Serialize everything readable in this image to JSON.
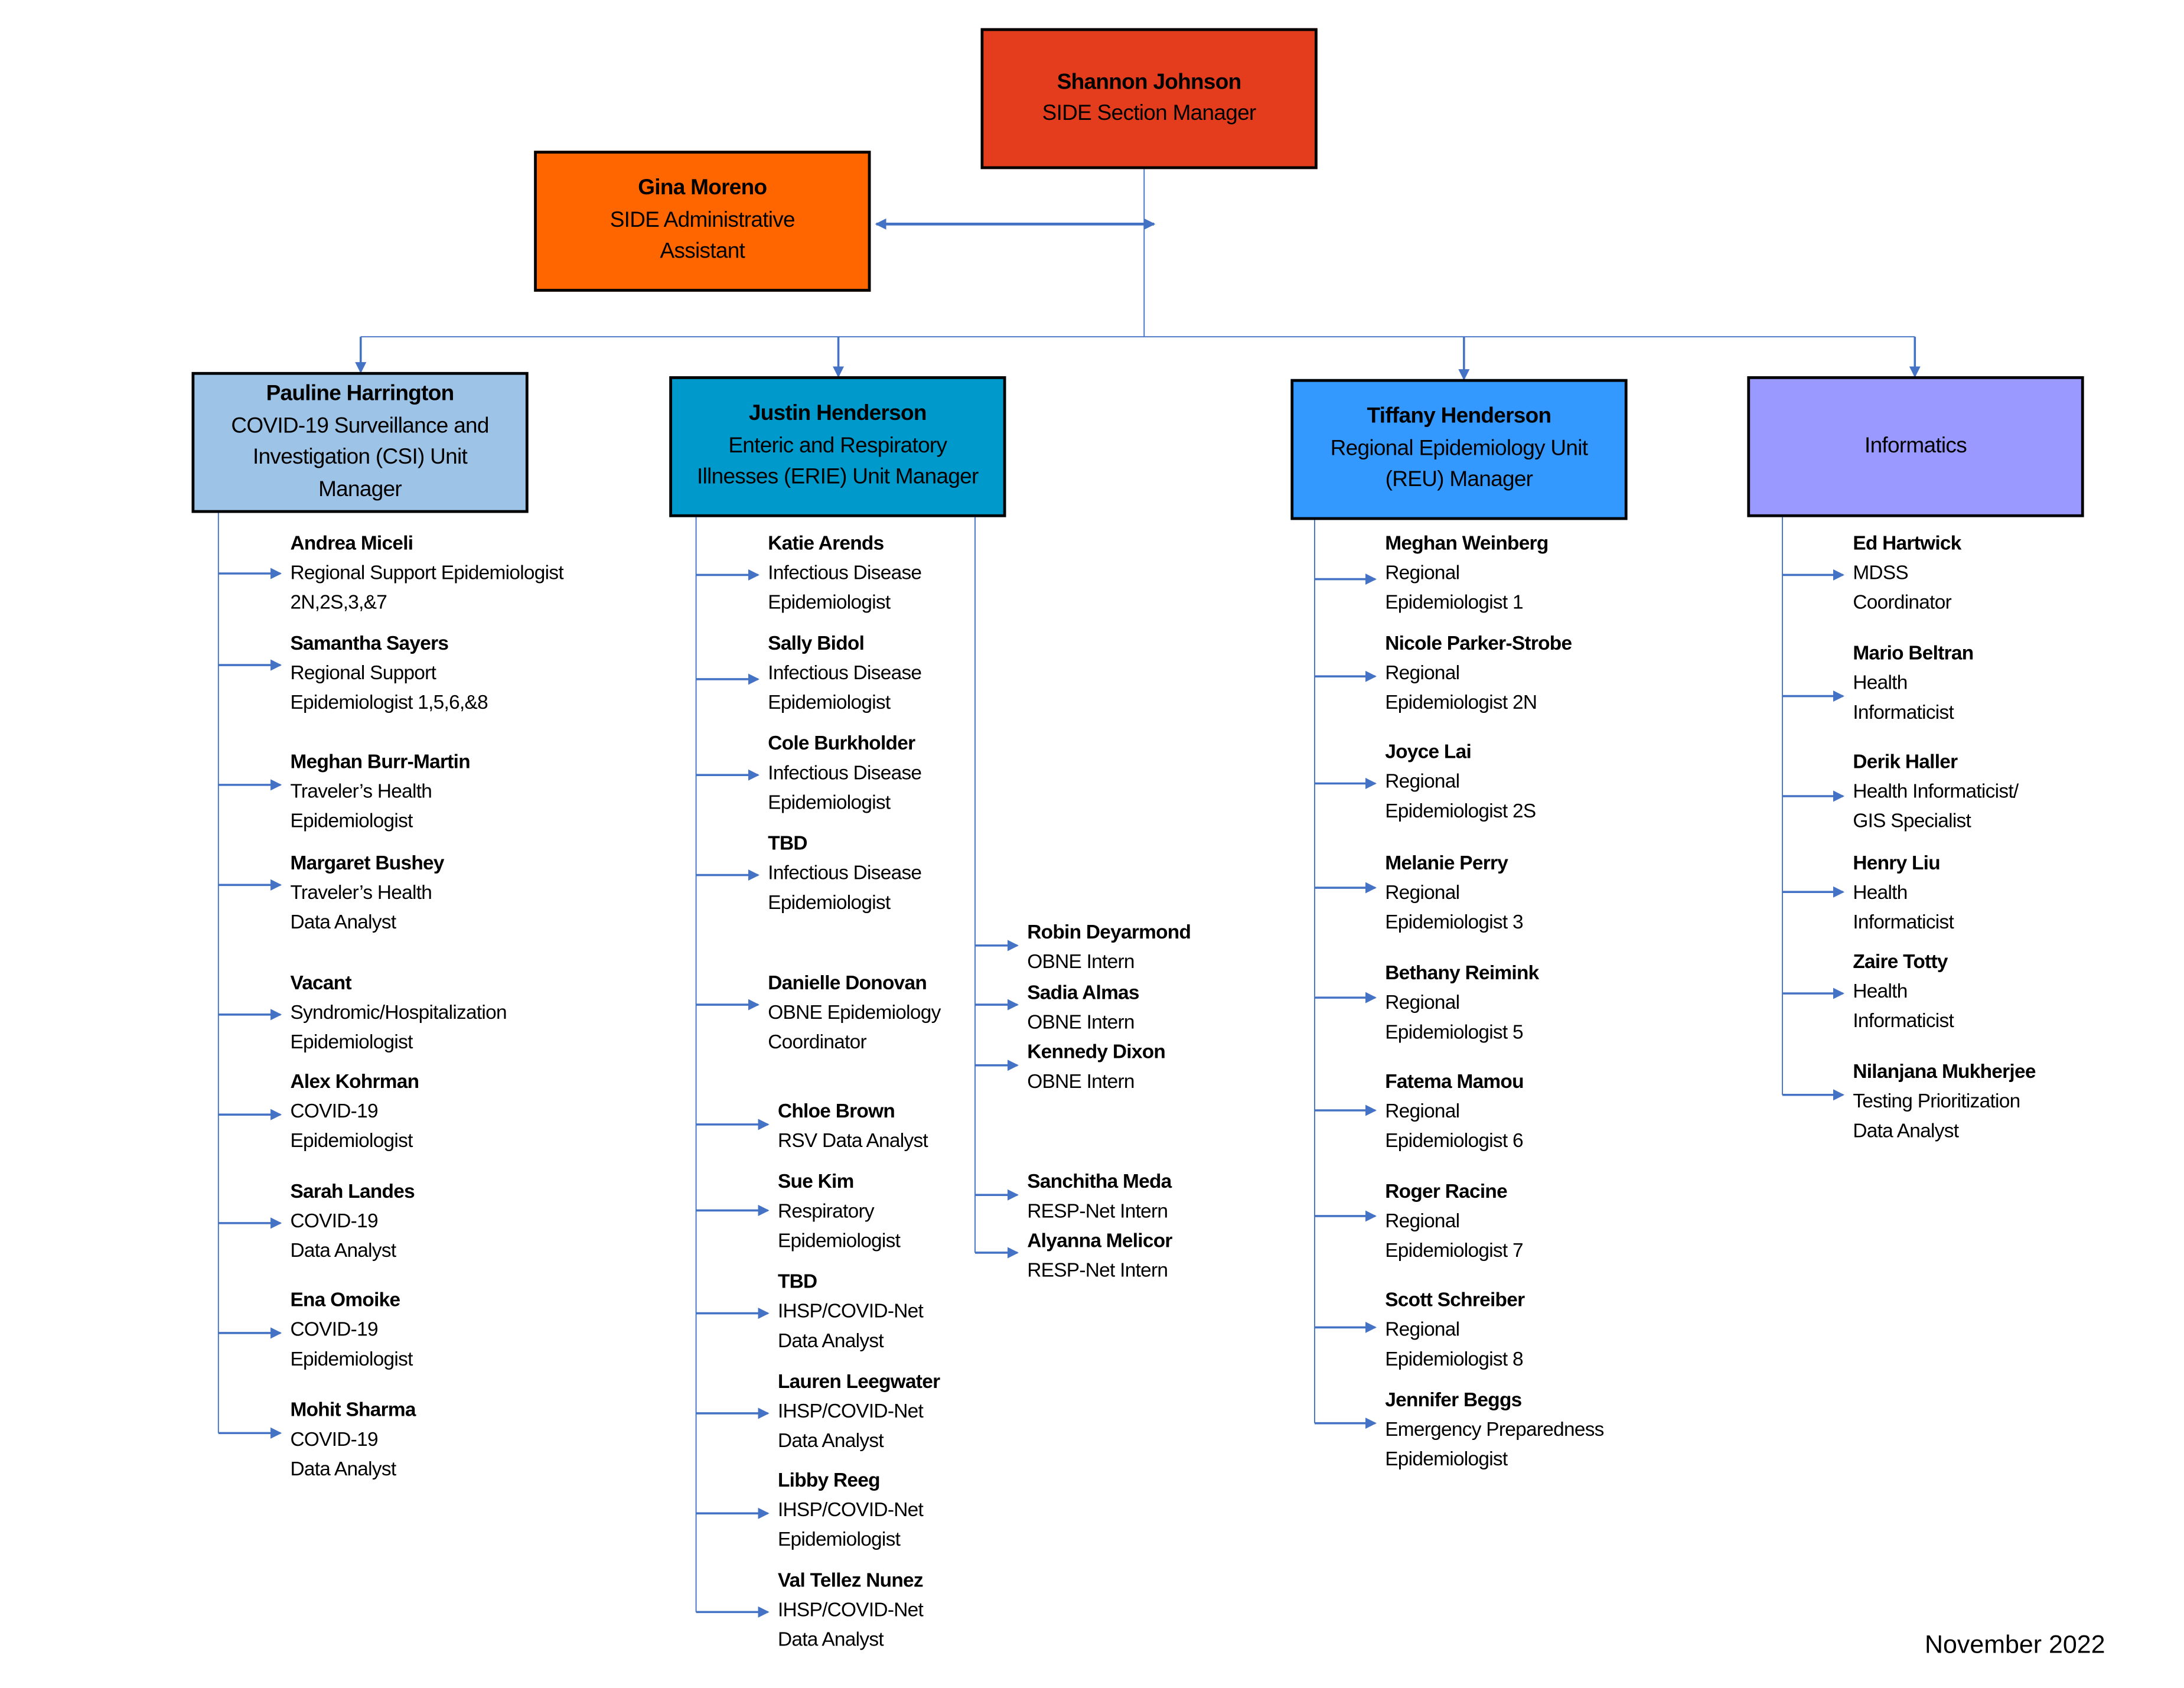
{
  "top": {
    "manager": {
      "name": "Shannon Johnson",
      "title": "SIDE Section Manager",
      "color": "#E33D1E"
    },
    "assistant": {
      "name": "Gina Moreno",
      "title_lines": [
        "SIDE Administrative",
        "Assistant"
      ],
      "color": "#FF6600"
    }
  },
  "units": [
    {
      "name": "Pauline Harrington",
      "title_lines": [
        "COVID-19 Surveillance and",
        "Investigation (CSI) Unit",
        "Manager"
      ],
      "color": "#9DC3E6",
      "staff": [
        {
          "name": "Andrea Miceli",
          "title_lines": [
            "Regional Support Epidemiologist",
            "2N,2S,3,&7"
          ]
        },
        {
          "name": "Samantha Sayers",
          "title_lines": [
            "Regional Support",
            "Epidemiologist 1,5,6,&8"
          ]
        },
        {
          "name": "Meghan Burr-Martin",
          "title_lines": [
            "Traveler’s Health",
            "Epidemiologist"
          ]
        },
        {
          "name": "Margaret Bushey",
          "title_lines": [
            "Traveler’s Health",
            "Data Analyst"
          ]
        },
        {
          "name": "Vacant",
          "title_lines": [
            "Syndromic/Hospitalization",
            "Epidemiologist"
          ]
        },
        {
          "name": "Alex Kohrman",
          "title_lines": [
            "COVID-19",
            "Epidemiologist"
          ]
        },
        {
          "name": "Sarah Landes",
          "title_lines": [
            "COVID-19",
            "Data Analyst"
          ]
        },
        {
          "name": "Ena Omoike",
          "title_lines": [
            "COVID-19",
            "Epidemiologist"
          ]
        },
        {
          "name": "Mohit Sharma",
          "title_lines": [
            "COVID-19",
            "Data Analyst"
          ]
        }
      ]
    },
    {
      "name": "Justin Henderson",
      "title_lines": [
        "Enteric and Respiratory",
        "Illnesses (ERIE) Unit Manager"
      ],
      "color": "#0099CC",
      "staff": [
        {
          "name": "Katie Arends",
          "title_lines": [
            "Infectious Disease",
            "Epidemiologist"
          ]
        },
        {
          "name": "Sally Bidol",
          "title_lines": [
            "Infectious Disease",
            "Epidemiologist"
          ]
        },
        {
          "name": "Cole Burkholder",
          "title_lines": [
            "Infectious Disease",
            "Epidemiologist"
          ]
        },
        {
          "name": "TBD",
          "title_lines": [
            "Infectious Disease",
            "Epidemiologist"
          ]
        },
        {
          "name": "Danielle Donovan",
          "title_lines": [
            "OBNE Epidemiology",
            "Coordinator"
          ]
        },
        {
          "name": "Chloe Brown",
          "title_lines": [
            "RSV Data Analyst"
          ]
        },
        {
          "name": "Sue Kim",
          "title_lines": [
            "Respiratory",
            "Epidemiologist"
          ]
        },
        {
          "name": "TBD",
          "title_lines": [
            "IHSP/COVID-Net",
            "Data Analyst"
          ]
        },
        {
          "name": "Lauren Leegwater",
          "title_lines": [
            "IHSP/COVID-Net",
            "Data Analyst"
          ]
        },
        {
          "name": "Libby Reeg",
          "title_lines": [
            "IHSP/COVID-Net",
            "Epidemiologist"
          ]
        },
        {
          "name": "Val Tellez Nunez",
          "title_lines": [
            "IHSP/COVID-Net",
            "Data Analyst"
          ]
        }
      ],
      "interns": [
        {
          "name": "Robin Deyarmond",
          "title_lines": [
            "OBNE Intern"
          ]
        },
        {
          "name": "Sadia Almas",
          "title_lines": [
            "OBNE Intern"
          ]
        },
        {
          "name": "Kennedy Dixon",
          "title_lines": [
            "OBNE Intern"
          ]
        },
        {
          "name": "Sanchitha Meda",
          "title_lines": [
            "RESP-Net Intern"
          ]
        },
        {
          "name": "Alyanna Melicor",
          "title_lines": [
            "RESP-Net Intern"
          ]
        }
      ]
    },
    {
      "name": "Tiffany Henderson",
      "title_lines": [
        "Regional Epidemiology Unit",
        "(REU) Manager"
      ],
      "color": "#3399FF",
      "staff": [
        {
          "name": "Meghan Weinberg",
          "title_lines": [
            "Regional",
            "Epidemiologist 1"
          ]
        },
        {
          "name": "Nicole Parker-Strobe",
          "title_lines": [
            "Regional",
            "Epidemiologist 2N"
          ]
        },
        {
          "name": "Joyce Lai",
          "title_lines": [
            "Regional",
            "Epidemiologist 2S"
          ]
        },
        {
          "name": "Melanie Perry",
          "title_lines": [
            "Regional",
            "Epidemiologist 3"
          ]
        },
        {
          "name": "Bethany Reimink",
          "title_lines": [
            "Regional",
            "Epidemiologist 5"
          ]
        },
        {
          "name": "Fatema Mamou",
          "title_lines": [
            "Regional",
            "Epidemiologist 6"
          ]
        },
        {
          "name": "Roger Racine",
          "title_lines": [
            "Regional",
            "Epidemiologist 7"
          ]
        },
        {
          "name": "Scott Schreiber",
          "title_lines": [
            "Regional",
            "Epidemiologist 8"
          ]
        },
        {
          "name": "Jennifer Beggs",
          "title_lines": [
            "Emergency Preparedness",
            "Epidemiologist"
          ]
        }
      ]
    },
    {
      "name": "",
      "title_lines": [
        "Informatics"
      ],
      "color": "#9999FF",
      "staff": [
        {
          "name": "Ed Hartwick",
          "title_lines": [
            "MDSS",
            "Coordinator"
          ]
        },
        {
          "name": "Mario Beltran",
          "title_lines": [
            "Health",
            "Informaticist"
          ]
        },
        {
          "name": "Derik Haller",
          "title_lines": [
            "Health Informaticist/",
            "GIS Specialist"
          ]
        },
        {
          "name": "Henry Liu",
          "title_lines": [
            "Health",
            "Informaticist"
          ]
        },
        {
          "name": "Zaire Totty",
          "title_lines": [
            "Health",
            "Informaticist"
          ]
        },
        {
          "name": "Nilanjana Mukherjee",
          "title_lines": [
            "Testing Prioritization",
            "Data Analyst"
          ]
        }
      ]
    }
  ],
  "connector_color": "#4472C4",
  "footer": {
    "date": "November 2022"
  }
}
